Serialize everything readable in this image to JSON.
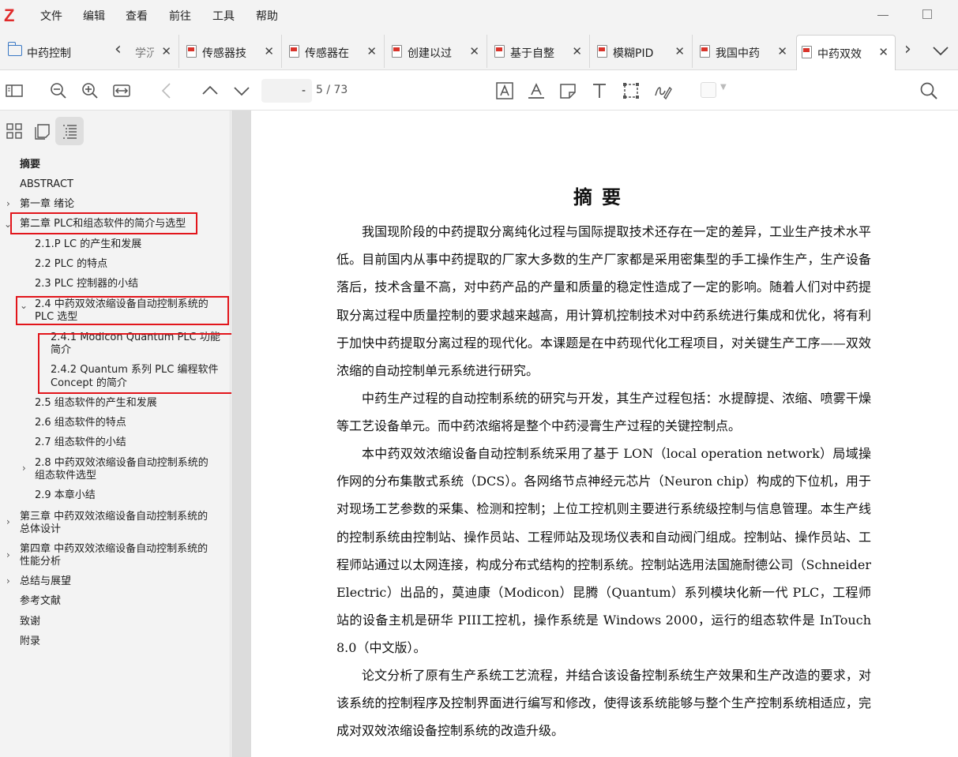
{
  "app": {
    "logo": "Z",
    "menu": [
      "文件",
      "编辑",
      "查看",
      "前往",
      "工具",
      "帮助"
    ]
  },
  "tabs": {
    "library_label": "中药控制",
    "items": [
      {
        "label": "学沉",
        "partial": true
      },
      {
        "label": "传感器技"
      },
      {
        "label": "传感器在"
      },
      {
        "label": "创建以过"
      },
      {
        "label": "基于自整"
      },
      {
        "label": "模糊PID"
      },
      {
        "label": "我国中药"
      },
      {
        "label": "中药双效",
        "active": true
      }
    ]
  },
  "toolbar": {
    "page_value": "-",
    "page_total": "5 / 73"
  },
  "sidebar": {
    "toc": [
      {
        "label": "摘要",
        "bold": true
      },
      {
        "label": "ABSTRACT"
      },
      {
        "label": "第一章 绪论"
      },
      {
        "label": "第二章 PLC和组态软件的简介与选型"
      },
      {
        "label": "2.1.P LC 的产生和发展"
      },
      {
        "label": "2.2 PLC 的特点"
      },
      {
        "label": "2.3 PLC 控制器的小结"
      },
      {
        "label": "2.4 中药双效浓缩设备自动控制系统的",
        "label2": "PLC 选型"
      },
      {
        "label": "2.4.1 Modicon Quantum PLC 功能",
        "label2": "简介"
      },
      {
        "label": "2.4.2 Quantum 系列 PLC 编程软件",
        "label2": "Concept 的简介"
      },
      {
        "label": "2.5 组态软件的产生和发展"
      },
      {
        "label": "2.6 组态软件的特点"
      },
      {
        "label": "2.7 组态软件的小结"
      },
      {
        "label": "2.8 中药双效浓缩设备自动控制系统的",
        "label2": "组态软件选型"
      },
      {
        "label": "2.9 本章小结"
      },
      {
        "label": "第三章 中药双效浓缩设备自动控制系统的",
        "label2": "总体设计"
      },
      {
        "label": "第四章 中药双效浓缩设备自动控制系统的",
        "label2": "性能分析"
      },
      {
        "label": "总结与展望"
      },
      {
        "label": "参考文献"
      },
      {
        "label": "致谢"
      },
      {
        "label": "附录"
      }
    ]
  },
  "document": {
    "title": "摘要",
    "paragraphs": [
      "我国现阶段的中药提取分离纯化过程与国际提取技术还存在一定的差异，工业生产技术水平低。目前国内从事中药提取的厂家大多数的生产厂家都是采用密集型的手工操作生产，生产设备落后，技术含量不高，对中药产品的产量和质量的稳定性造成了一定的影响。随着人们对中药提取分离过程中质量控制的要求越来越高，用计算机控制技术对中药系统进行集成和优化，将有利于加快中药提取分离过程的现代化。本课题是在中药现代化工程项目，对关键生产工序——双效浓缩的自动控制单元系统进行研究。",
      "中药生产过程的自动控制系统的研究与开发，其生产过程包括：水提醇提、浓缩、喷雾干燥等工艺设备单元。而中药浓缩将是整个中药浸膏生产过程的关键控制点。",
      "本中药双效浓缩设备自动控制系统采用了基于 LON（local operation network）局域操作网的分布集散式系统（DCS）。各网络节点神经元芯片（Neuron chip）构成的下位机，用于对现场工艺参数的采集、检测和控制；上位工控机则主要进行系统级控制与信息管理。本生产线的控制系统由控制站、操作员站、工程师站及现场仪表和自动阀门组成。控制站、操作员站、工程师站通过以太网连接，构成分布式结构的控制系统。控制站选用法国施耐德公司（Schneider Electric）出品的，莫迪康（Modicon）昆腾（Quantum）系列模块化新一代 PLC，工程师站的设备主机是研华 PIII工控机，操作系统是 Windows 2000，运行的组态软件是 InTouch 8.0（中文版）。",
      "论文分析了原有生产系统工艺流程，并结合该设备控制系统生产效果和生产改造的要求，对该系统的控制程序及控制界面进行编写和修改，使得该系统能够与整个生产控制系统相适应，完成对双效浓缩设备控制系统的改造升级。"
    ]
  }
}
